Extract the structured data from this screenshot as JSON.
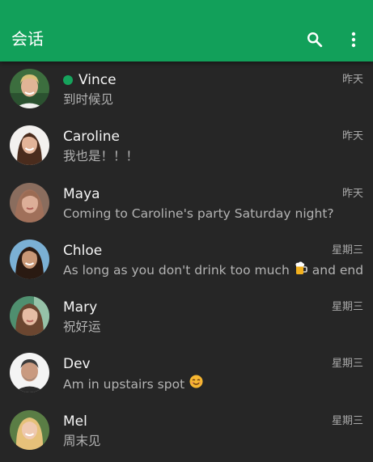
{
  "appbar": {
    "title": "会话",
    "color": "#12a05a",
    "actions": [
      "search-icon",
      "more-vert-icon"
    ]
  },
  "conversations": [
    {
      "name": "Vince",
      "online": true,
      "time": "昨天",
      "preview": "到时候见"
    },
    {
      "name": "Caroline",
      "online": false,
      "time": "昨天",
      "preview": "我也是！！！"
    },
    {
      "name": "Maya",
      "online": false,
      "time": "昨天",
      "preview": "Coming to Caroline's party Saturday night?"
    },
    {
      "name": "Chloe",
      "online": false,
      "time": "星期三",
      "preview_before": "As long as you don't drink too much",
      "preview_emoji": "beer-mug-emoji",
      "preview_after": "and end u..."
    },
    {
      "name": "Mary",
      "online": false,
      "time": "星期三",
      "preview": "祝好运"
    },
    {
      "name": "Dev",
      "online": false,
      "time": "星期三",
      "preview_before": "Am in upstairs spot",
      "preview_emoji": "smiling-face-emoji",
      "preview_after": ""
    },
    {
      "name": "Mel",
      "online": false,
      "time": "星期三",
      "preview": "周末见"
    }
  ]
}
